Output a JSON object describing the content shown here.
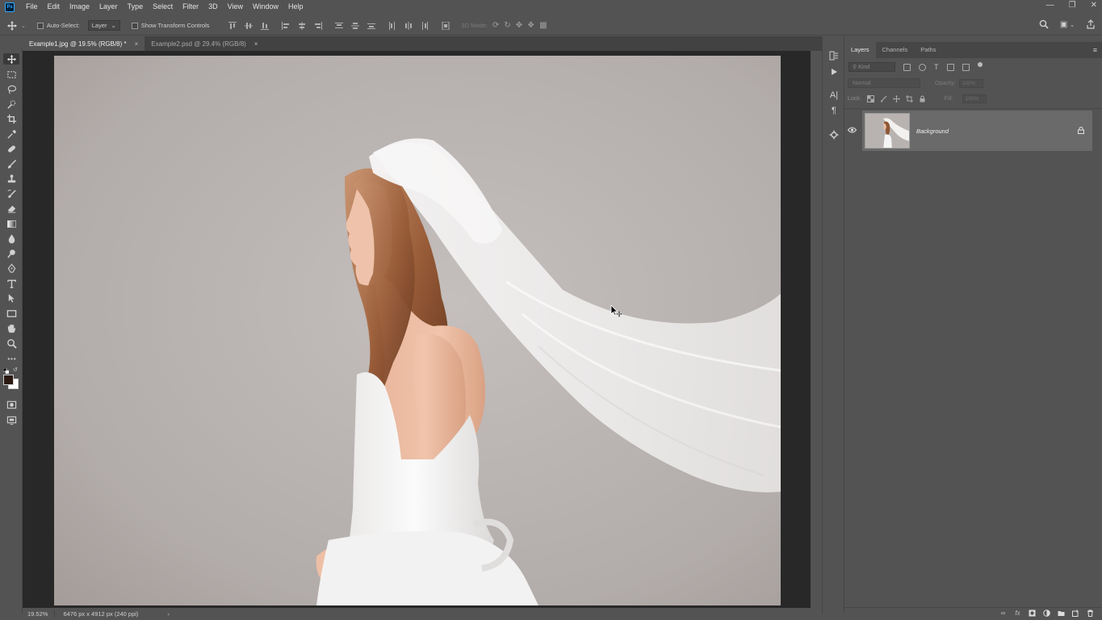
{
  "menubar": {
    "logo": "Ps",
    "items": [
      "File",
      "Edit",
      "Image",
      "Layer",
      "Type",
      "Select",
      "Filter",
      "3D",
      "View",
      "Window",
      "Help"
    ]
  },
  "options": {
    "auto_select_label": "Auto-Select:",
    "auto_select_target": "Layer",
    "show_transform_label": "Show Transform Controls",
    "threed_mode_label": "3D Mode:"
  },
  "tabs": [
    {
      "label": "Example1.jpg @ 19.5% (RGB/8) *",
      "active": true
    },
    {
      "label": "Example2.psd @ 29.4% (RGB/8)",
      "active": false
    }
  ],
  "tab_close_glyph": "×",
  "status": {
    "zoom": "19.52%",
    "doc_info": "6476 px x 4912 px (240 ppi)",
    "arrow": "›"
  },
  "layers_panel": {
    "tabs": [
      "Layers",
      "Channels",
      "Paths"
    ],
    "kind_placeholder": "Kind",
    "blend_mode": "Normal",
    "opacity_label": "Opacity:",
    "opacity_value": "100%",
    "lock_label": "Lock:",
    "fill_label": "Fill:",
    "fill_value": "100%",
    "layers": [
      {
        "name": "Background",
        "visible": true,
        "locked": true
      }
    ],
    "footer_icons": [
      "link-icon",
      "fx-icon",
      "mask-icon",
      "adjustment-icon",
      "group-icon",
      "new-layer-icon",
      "trash-icon"
    ]
  },
  "colors": {
    "ui_bg": "#535353",
    "dark_bg": "#282828",
    "tab_bg": "#424242",
    "selected_layer": "#6a6a6a",
    "backdrop": "#b4aeab",
    "foreground_swatch": "#2b1a12",
    "background_swatch": "#ffffff"
  }
}
